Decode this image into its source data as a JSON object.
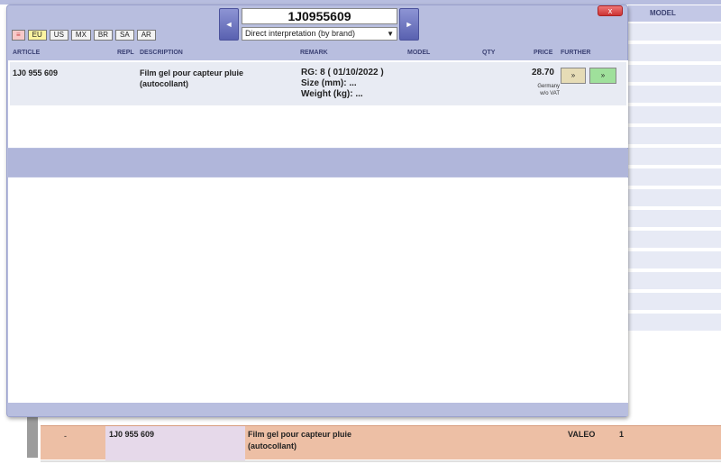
{
  "background": {
    "header_model": "MODEL",
    "row": {
      "dash": "-",
      "article": "1J0 955 609",
      "description_line1": "Film gel pour capteur pluie",
      "description_line2": "(autocollant)",
      "brand": "VALEO",
      "qty": "1"
    }
  },
  "modal": {
    "close_label": "x",
    "regions": [
      "≡",
      "EU",
      "US",
      "MX",
      "BR",
      "SA",
      "AR"
    ],
    "active_region": "EU",
    "nav_prev": "◄",
    "nav_next": "►",
    "part_number": "1J0955609",
    "interpretation": "Direct interpretation (by brand)",
    "columns": {
      "article": "ARTICLE",
      "repl": "REPL",
      "description": "DESCRIPTION",
      "remark": "REMARK",
      "model": "MODEL",
      "qty": "QTY",
      "price": "PRICE",
      "further": "FURTHER"
    },
    "result": {
      "article": "1J0 955 609",
      "description_line1": "Film gel pour capteur pluie",
      "description_line2": "(autocollant)",
      "remark_line1": "RG: 8 ( 01/10/2022 )",
      "remark_line2": "Size (mm): ...",
      "remark_line3": "Weight (kg): ...",
      "price": "28.70",
      "price_note_line1": "Germany",
      "price_note_line2": "w/o VAT",
      "info_button": "»",
      "add_button": "»"
    }
  }
}
